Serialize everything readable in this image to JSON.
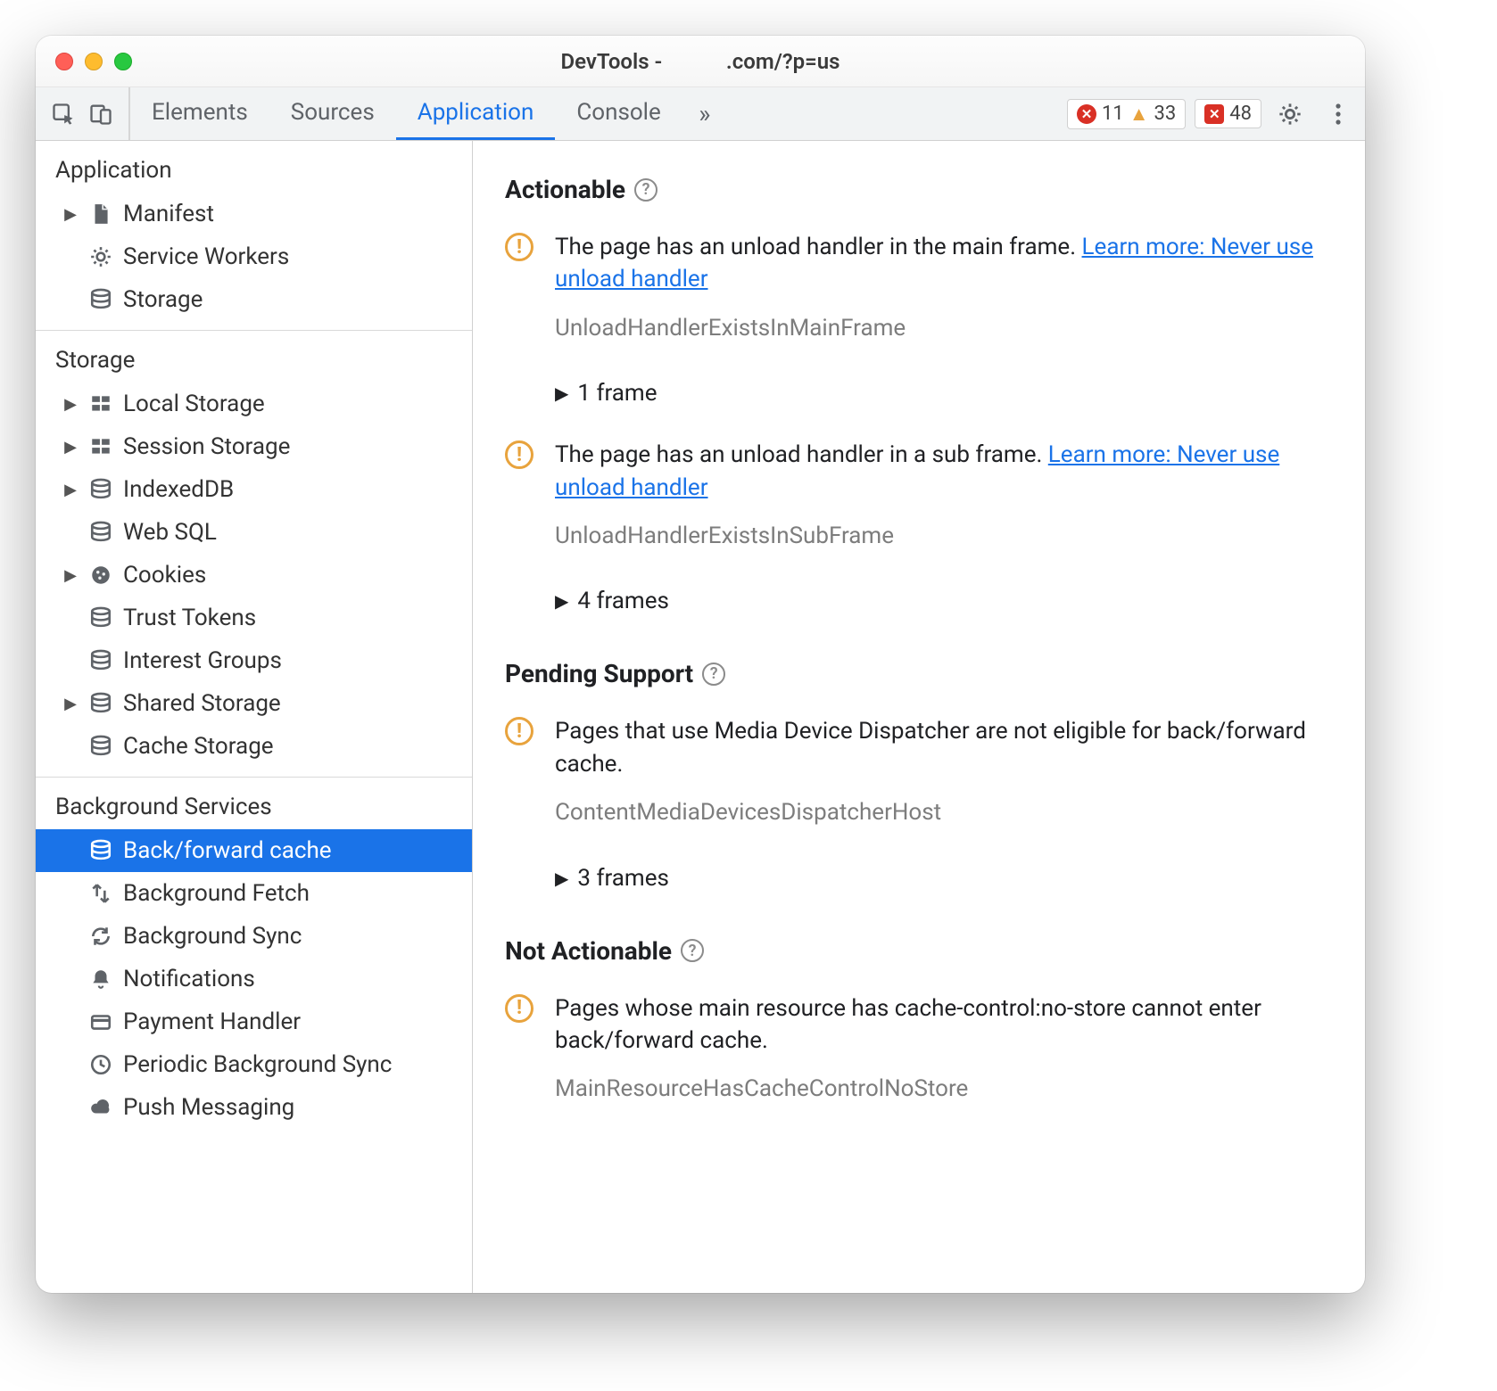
{
  "titlebar": {
    "title_prefix": "DevTools - ",
    "title_suffix": ".com/?p=us"
  },
  "toolbar": {
    "tabs": [
      "Elements",
      "Sources",
      "Application",
      "Console"
    ],
    "active_tab": "Application",
    "errors": "11",
    "warnings": "33",
    "issues": "48"
  },
  "sidebar": {
    "sections": [
      {
        "title": "Application",
        "items": [
          {
            "label": "Manifest",
            "icon": "file-icon",
            "expandable": true
          },
          {
            "label": "Service Workers",
            "icon": "gear-icon",
            "expandable": false
          },
          {
            "label": "Storage",
            "icon": "db-icon",
            "expandable": false
          }
        ]
      },
      {
        "title": "Storage",
        "items": [
          {
            "label": "Local Storage",
            "icon": "grid-icon",
            "expandable": true
          },
          {
            "label": "Session Storage",
            "icon": "grid-icon",
            "expandable": true
          },
          {
            "label": "IndexedDB",
            "icon": "db-icon",
            "expandable": true
          },
          {
            "label": "Web SQL",
            "icon": "db-icon",
            "expandable": false
          },
          {
            "label": "Cookies",
            "icon": "cookie-icon",
            "expandable": true
          },
          {
            "label": "Trust Tokens",
            "icon": "db-icon",
            "expandable": false
          },
          {
            "label": "Interest Groups",
            "icon": "db-icon",
            "expandable": false
          },
          {
            "label": "Shared Storage",
            "icon": "db-icon",
            "expandable": true
          },
          {
            "label": "Cache Storage",
            "icon": "db-icon",
            "expandable": false
          }
        ]
      },
      {
        "title": "Background Services",
        "items": [
          {
            "label": "Back/forward cache",
            "icon": "db-icon",
            "selected": true
          },
          {
            "label": "Background Fetch",
            "icon": "transfer-icon"
          },
          {
            "label": "Background Sync",
            "icon": "sync-icon"
          },
          {
            "label": "Notifications",
            "icon": "bell-icon"
          },
          {
            "label": "Payment Handler",
            "icon": "card-icon"
          },
          {
            "label": "Periodic Background Sync",
            "icon": "clock-icon"
          },
          {
            "label": "Push Messaging",
            "icon": "cloud-icon"
          }
        ]
      }
    ]
  },
  "main": {
    "sections": [
      {
        "heading": "Actionable",
        "issues": [
          {
            "text": "The page has an unload handler in the main frame. ",
            "link": "Learn more: Never use unload handler",
            "code": "UnloadHandlerExistsInMainFrame",
            "frames": "1 frame"
          },
          {
            "text": "The page has an unload handler in a sub frame. ",
            "link": "Learn more: Never use unload handler",
            "code": "UnloadHandlerExistsInSubFrame",
            "frames": "4 frames"
          }
        ]
      },
      {
        "heading": "Pending Support",
        "issues": [
          {
            "text": "Pages that use Media Device Dispatcher are not eligible for back/forward cache.",
            "code": "ContentMediaDevicesDispatcherHost",
            "frames": "3 frames"
          }
        ]
      },
      {
        "heading": "Not Actionable",
        "issues": [
          {
            "text": "Pages whose main resource has cache-control:no-store cannot enter back/forward cache.",
            "code": "MainResourceHasCacheControlNoStore"
          }
        ]
      }
    ]
  }
}
